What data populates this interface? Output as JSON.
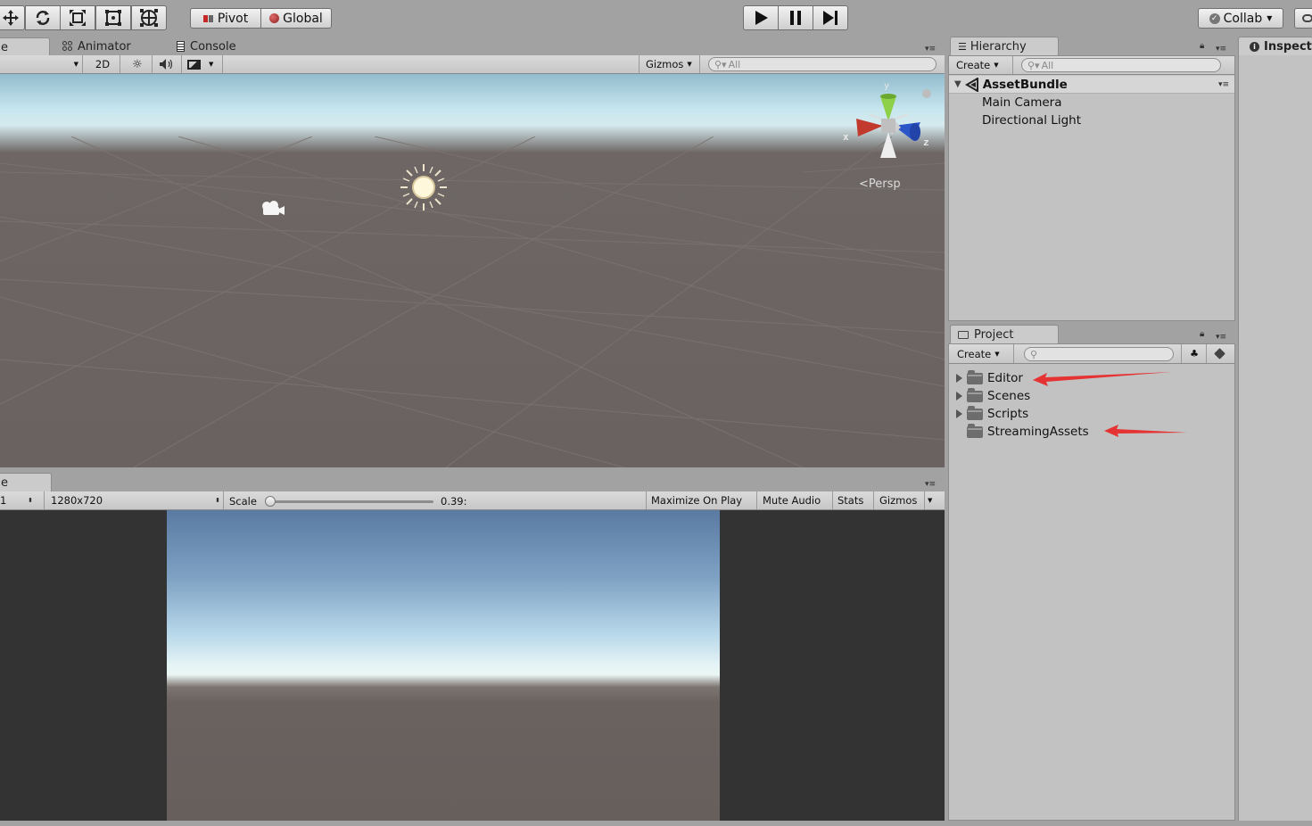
{
  "colors": {
    "window_bg": "#a2a2a2",
    "panel_bg": "#c2c2c2",
    "selected_row": "#d6d6d6",
    "sky_top": "#a8d4e2",
    "ground": "#6b6360",
    "game_dark": "#333333",
    "annotation_arrow": "#e53333"
  },
  "top_toolbar": {
    "transform_tools": [
      "move-icon",
      "rotate-icon",
      "scale-icon",
      "rect-tool-icon",
      "transform-icon"
    ],
    "pivot_label": "Pivot",
    "global_label": "Global",
    "play_icons": [
      "play-icon",
      "pause-icon",
      "step-icon"
    ],
    "collab_label": "Collab"
  },
  "scene_view": {
    "tabs": {
      "scene": "e",
      "animator": "Animator",
      "console": "Console"
    },
    "toolbar": {
      "mode_2d": "2D",
      "gizmos": "Gizmos",
      "search_placeholder": "All"
    },
    "gizmo": {
      "y": "y",
      "x": "x",
      "z": "z",
      "projection": "Persp"
    }
  },
  "game_view": {
    "tab": "e",
    "toolbar": {
      "display": "1",
      "resolution": "1280x720",
      "scale_label": "Scale",
      "scale_value": "0.39:",
      "scale_fraction": 0.0,
      "maximize": "Maximize On Play",
      "mute": "Mute Audio",
      "stats": "Stats",
      "gizmos": "Gizmos"
    }
  },
  "hierarchy": {
    "tab": "Hierarchy",
    "create": "Create",
    "search_placeholder": "All",
    "scene_name": "AssetBundle",
    "items": [
      "Main Camera",
      "Directional Light"
    ]
  },
  "project": {
    "tab": "Project",
    "create": "Create",
    "folders": [
      {
        "name": "Editor",
        "expandable": true,
        "arrow": true
      },
      {
        "name": "Scenes",
        "expandable": true,
        "arrow": false
      },
      {
        "name": "Scripts",
        "expandable": true,
        "arrow": false
      },
      {
        "name": "StreamingAssets",
        "expandable": false,
        "arrow": true
      }
    ]
  },
  "inspector": {
    "tab": "Inspect"
  }
}
